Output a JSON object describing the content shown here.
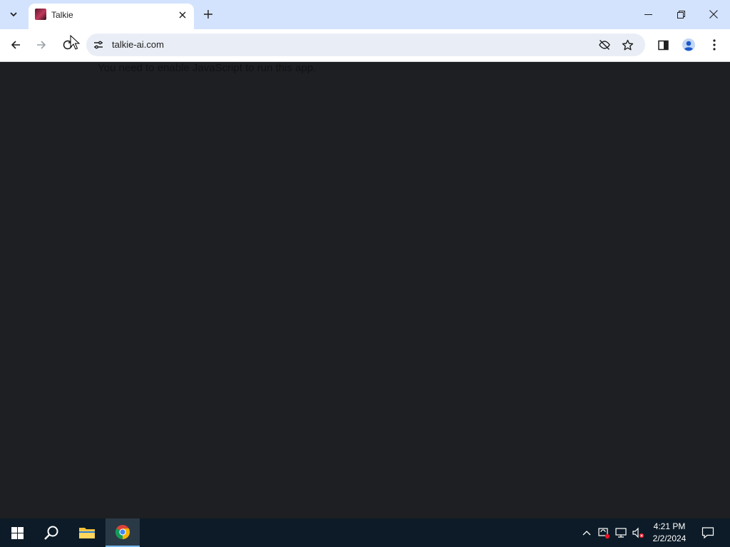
{
  "browser": {
    "tab": {
      "title": "Talkie"
    },
    "url": "talkie-ai.com"
  },
  "page": {
    "noscript_message": "You need to enable JavaScript to run this app."
  },
  "taskbar": {
    "clock_time": "4:21 PM",
    "clock_date": "2/2/2024"
  }
}
